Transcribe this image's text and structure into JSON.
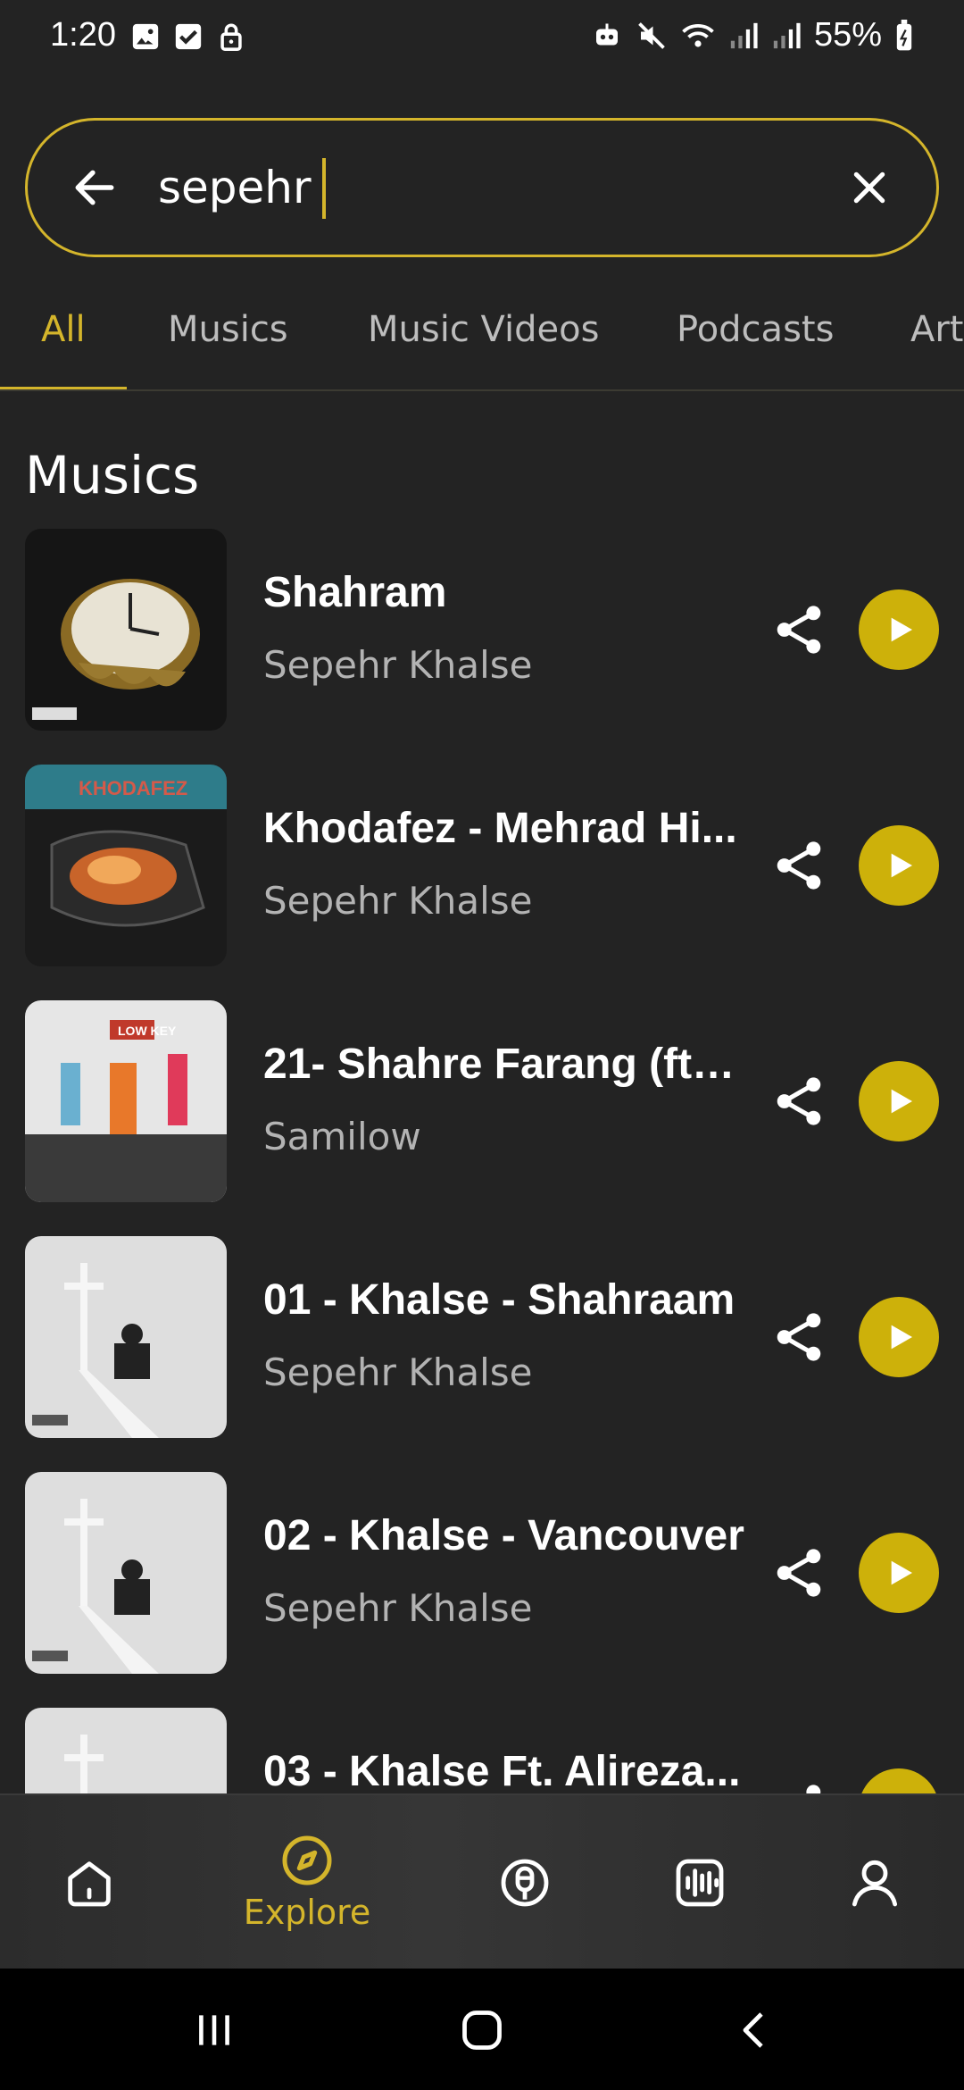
{
  "status_bar": {
    "time": "1:20",
    "battery": "55%",
    "left_icons": [
      "image-icon",
      "checkbox-icon",
      "lock-icon"
    ],
    "right_icons": [
      "robot-icon",
      "mute-icon",
      "wifi-icon",
      "signal-icon",
      "signal-icon-2",
      "battery-icon"
    ]
  },
  "search": {
    "value": "sepehr",
    "back_icon": "arrow-left-icon",
    "clear_icon": "close-icon"
  },
  "tabs": [
    {
      "label": "All",
      "active": true
    },
    {
      "label": "Musics",
      "active": false
    },
    {
      "label": "Music Videos",
      "active": false
    },
    {
      "label": "Podcasts",
      "active": false
    },
    {
      "label": "Art",
      "active": false
    }
  ],
  "section": {
    "title": "Musics"
  },
  "tracks": [
    {
      "title": "Shahram",
      "artist": "Sepehr Khalse",
      "cover": "clock-cover"
    },
    {
      "title": "Khodafez - Mehrad Hi...",
      "artist": "Sepehr Khalse",
      "cover": "khodafez-cover",
      "cover_text": "KHODAFEZ"
    },
    {
      "title": "21- Shahre Farang (ft. ...",
      "artist": "Samilow",
      "cover": "lowkey-cover",
      "cover_text": "LOW KEY"
    },
    {
      "title": "01 - Khalse - Shahraam",
      "artist": "Sepehr Khalse",
      "cover": "cross-cover"
    },
    {
      "title": "02 - Khalse - Vancouver",
      "artist": "Sepehr Khalse",
      "cover": "cross-cover"
    },
    {
      "title": "03 - Khalse Ft. Alireza...",
      "artist": "",
      "cover": "cross-cover"
    }
  ],
  "bottom_nav": {
    "items": [
      {
        "icon": "home-icon",
        "label": ""
      },
      {
        "icon": "compass-icon",
        "label": "Explore",
        "active": true
      },
      {
        "icon": "podcast-icon",
        "label": ""
      },
      {
        "icon": "waveform-icon",
        "label": ""
      },
      {
        "icon": "profile-icon",
        "label": ""
      }
    ]
  },
  "colors": {
    "background": "#232323",
    "accent": "#d4b52b",
    "play_button": "#cdb10a",
    "secondary_text": "#b3b3b3"
  }
}
